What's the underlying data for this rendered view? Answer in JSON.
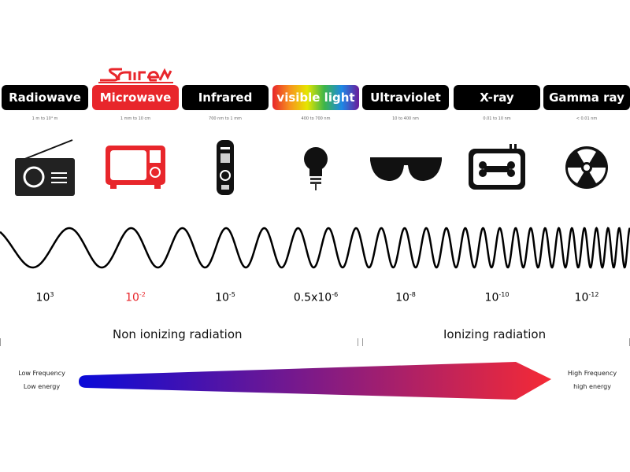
{
  "logo": {
    "text": "sairem",
    "color": "#e8262b"
  },
  "bands": [
    {
      "label": "Radiowave",
      "range": "1 m to 10⁴ m",
      "wavelength_base": "10",
      "wavelength_exp": "3",
      "bg": "#000000",
      "icon": "radio-icon"
    },
    {
      "label": "Microwave",
      "range": "1 mm to 10 cm",
      "wavelength_base": "10",
      "wavelength_exp": "-2",
      "bg": "#e8262b",
      "icon": "microwave-oven-icon"
    },
    {
      "label": "Infrared",
      "range": "700 nm to 1 mm",
      "wavelength_base": "10",
      "wavelength_exp": "-5",
      "bg": "#000000",
      "icon": "remote-control-icon"
    },
    {
      "label": "visible light",
      "range": "400 to 700 nm",
      "wavelength_base": "0.5x10",
      "wavelength_exp": "-6",
      "bg": "rainbow",
      "icon": "light-bulb-icon"
    },
    {
      "label": "Ultraviolet",
      "range": "10 to 400 nm",
      "wavelength_base": "10",
      "wavelength_exp": "-8",
      "bg": "#000000",
      "icon": "sunglasses-icon"
    },
    {
      "label": "X-ray",
      "range": "0.01 to 10 nm",
      "wavelength_base": "10",
      "wavelength_exp": "-10",
      "bg": "#000000",
      "icon": "xray-bone-icon"
    },
    {
      "label": "Gamma ray",
      "range": "< 0.01 nm",
      "wavelength_base": "10",
      "wavelength_exp": "-12",
      "bg": "#000000",
      "icon": "radiation-icon"
    }
  ],
  "zones": {
    "non_ionizing": "Non ionizing radiation",
    "ionizing": "Ionizing radiation"
  },
  "scale": {
    "low_frequency": "Low Frequency",
    "low_energy": "Low energy",
    "high_frequency": "High Frequency",
    "high_energy": "high energy",
    "start_color": "#0a0ad8",
    "end_color": "#f52a35"
  }
}
